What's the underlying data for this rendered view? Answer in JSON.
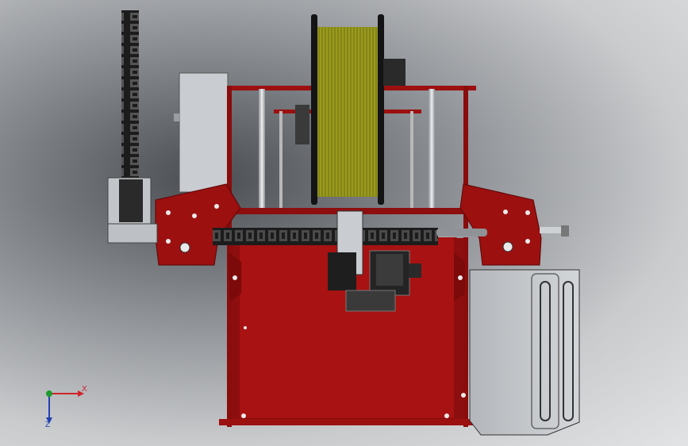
{
  "view": {
    "background_dark": "#3f4247",
    "background_light": "#e3e4e5",
    "frame_color": "#9c1010",
    "frame_dark": "#6a0808",
    "plate_color": "#a81212",
    "spool_color": "#9a9a1e",
    "chain_color": "#1c1c1c",
    "metal_color": "#bfc2c6",
    "motor_color": "#2a2a2a"
  },
  "triad": {
    "x_label": "X",
    "z_label": "Z",
    "x_color": "#d0232a",
    "z_color": "#2240b0",
    "origin_color": "#1f9a2f"
  }
}
